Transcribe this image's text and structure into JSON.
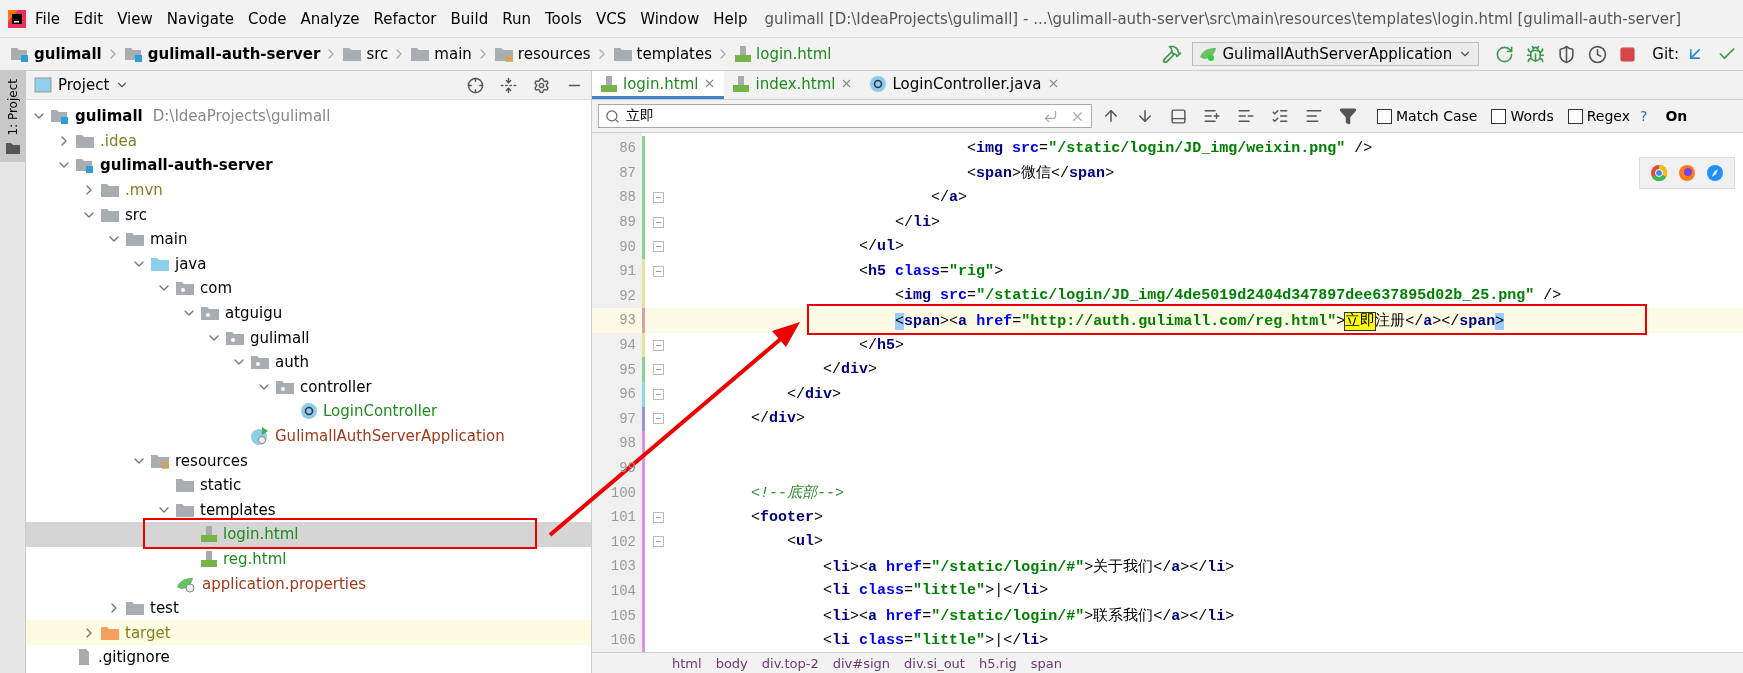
{
  "menu_bar": {
    "items": [
      "File",
      "Edit",
      "View",
      "Navigate",
      "Code",
      "Analyze",
      "Refactor",
      "Build",
      "Run",
      "Tools",
      "VCS",
      "Window",
      "Help"
    ],
    "title": "gulimall [D:\\IdeaProjects\\gulimall] - ...\\gulimall-auth-server\\src\\main\\resources\\templates\\login.html [gulimall-auth-server]"
  },
  "nav_bar": {
    "crumbs": [
      {
        "label": "gulimall",
        "kind": "module"
      },
      {
        "label": "gulimall-auth-server",
        "kind": "module"
      },
      {
        "label": "src",
        "kind": "folder"
      },
      {
        "label": "main",
        "kind": "folder"
      },
      {
        "label": "resources",
        "kind": "resource-folder"
      },
      {
        "label": "templates",
        "kind": "folder"
      },
      {
        "label": "login.html",
        "kind": "html"
      }
    ],
    "run_config": "GulimallAuthServerApplication",
    "git_label": "Git:"
  },
  "tool_stripe": {
    "label": "1: Project"
  },
  "project_panel": {
    "title": "Project",
    "tree": [
      {
        "label": "gulimall",
        "path": "D:\\IdeaProjects\\gulimall",
        "kind": "module",
        "color": "#000000",
        "expanded": true,
        "selected": false,
        "children": [
          {
            "label": ".idea",
            "kind": "folder",
            "color": "#7f7f20",
            "expanded": false,
            "selected": false
          },
          {
            "label": "gulimall-auth-server",
            "kind": "module",
            "color": "#000000",
            "expanded": true,
            "selected": false,
            "children": [
              {
                "label": ".mvn",
                "kind": "folder",
                "color": "#7f7f20",
                "expanded": false,
                "selected": false
              },
              {
                "label": "src",
                "kind": "folder",
                "color": "#000000",
                "expanded": true,
                "selected": false,
                "children": [
                  {
                    "label": "main",
                    "kind": "folder",
                    "color": "#000000",
                    "expanded": true,
                    "selected": false,
                    "children": [
                      {
                        "label": "java",
                        "kind": "source-folder",
                        "color": "#000000",
                        "expanded": true,
                        "selected": false,
                        "children": [
                          {
                            "label": "com",
                            "kind": "package",
                            "color": "#000000",
                            "expanded": true,
                            "selected": false,
                            "children": [
                              {
                                "label": "atguigu",
                                "kind": "package",
                                "color": "#000000",
                                "expanded": true,
                                "selected": false,
                                "children": [
                                  {
                                    "label": "gulimall",
                                    "kind": "package",
                                    "color": "#000000",
                                    "expanded": true,
                                    "selected": false,
                                    "children": [
                                      {
                                        "label": "auth",
                                        "kind": "package",
                                        "color": "#000000",
                                        "expanded": true,
                                        "selected": false,
                                        "children": [
                                          {
                                            "label": "controller",
                                            "kind": "package",
                                            "color": "#000000",
                                            "expanded": true,
                                            "selected": false,
                                            "children": [
                                              {
                                                "label": "LoginController",
                                                "kind": "class",
                                                "color": "#1e8a1e",
                                                "selected": false
                                              }
                                            ]
                                          }
                                        ]
                                      },
                                      {
                                        "label": "GulimallAuthServerApplication",
                                        "kind": "app-class",
                                        "color": "#a33a1a",
                                        "selected": false
                                      }
                                    ]
                                  }
                                ]
                              }
                            ]
                          }
                        ]
                      },
                      {
                        "label": "resources",
                        "kind": "resource-folder",
                        "color": "#000000",
                        "expanded": true,
                        "selected": false,
                        "children": [
                          {
                            "label": "static",
                            "kind": "folder",
                            "color": "#000000",
                            "selected": false
                          },
                          {
                            "label": "templates",
                            "kind": "folder",
                            "color": "#000000",
                            "expanded": true,
                            "selected": false,
                            "children": [
                              {
                                "label": "login.html",
                                "kind": "html",
                                "color": "#1e8a1e",
                                "selected": true
                              },
                              {
                                "label": "reg.html",
                                "kind": "html",
                                "color": "#1e8a1e",
                                "selected": false
                              }
                            ]
                          },
                          {
                            "label": "application.properties",
                            "kind": "properties",
                            "color": "#a33a1a",
                            "selected": false
                          }
                        ]
                      }
                    ]
                  },
                  {
                    "label": "test",
                    "kind": "folder",
                    "color": "#000000",
                    "expanded": false,
                    "selected": false
                  }
                ]
              },
              {
                "label": "target",
                "kind": "excluded-folder",
                "color": "#7f7f20",
                "expanded": false,
                "selected": false
              }
            ]
          },
          {
            "label": ".gitignore",
            "kind": "file",
            "color": "#000000",
            "selected": false
          }
        ]
      }
    ]
  },
  "editor": {
    "tabs": [
      {
        "label": "login.html",
        "kind": "html",
        "selected": true
      },
      {
        "label": "index.html",
        "kind": "html",
        "selected": false
      },
      {
        "label": "LoginController.java",
        "kind": "class",
        "selected": false
      }
    ],
    "search": {
      "value": "立即",
      "options": [
        {
          "label": "Match Case",
          "checked": false
        },
        {
          "label": "Words",
          "checked": false
        },
        {
          "label": "Regex",
          "checked": false
        }
      ],
      "help": "?",
      "cut_label": "On"
    },
    "lines": [
      {
        "number": "86",
        "color": "#8fd18f",
        "fold": false,
        "current": false,
        "tokens": [
          {
            "kind": "punct",
            "text": "                                <"
          },
          {
            "kind": "tag",
            "text": "img"
          },
          {
            "kind": "attr",
            "text": " src"
          },
          {
            "kind": "punct",
            "text": "="
          },
          {
            "kind": "value",
            "text": "\"/static/login/JD_img/weixin.png\""
          },
          {
            "kind": "punct",
            "text": " />"
          }
        ]
      },
      {
        "number": "87",
        "color": "#8fd18f",
        "fold": false,
        "current": false,
        "tokens": [
          {
            "kind": "punct",
            "text": "                                <"
          },
          {
            "kind": "tag",
            "text": "span"
          },
          {
            "kind": "punct",
            "text": ">"
          },
          {
            "kind": "text",
            "text": "微信"
          },
          {
            "kind": "punct",
            "text": "</"
          },
          {
            "kind": "tag",
            "text": "span"
          },
          {
            "kind": "punct",
            "text": ">"
          }
        ]
      },
      {
        "number": "88",
        "color": "#8fd18f",
        "fold": true,
        "current": false,
        "tokens": [
          {
            "kind": "punct",
            "text": "                            </"
          },
          {
            "kind": "tag",
            "text": "a"
          },
          {
            "kind": "punct",
            "text": ">"
          }
        ]
      },
      {
        "number": "89",
        "color": "#8fd18f",
        "fold": true,
        "current": false,
        "tokens": [
          {
            "kind": "punct",
            "text": "                        </"
          },
          {
            "kind": "tag",
            "text": "li"
          },
          {
            "kind": "punct",
            "text": ">"
          }
        ]
      },
      {
        "number": "90",
        "color": "#8fd18f",
        "fold": true,
        "current": false,
        "tokens": [
          {
            "kind": "punct",
            "text": "                    </"
          },
          {
            "kind": "tag",
            "text": "ul"
          },
          {
            "kind": "punct",
            "text": ">"
          }
        ]
      },
      {
        "number": "91",
        "color": "#e8e0a0",
        "fold": true,
        "current": false,
        "tokens": [
          {
            "kind": "punct",
            "text": "                    <"
          },
          {
            "kind": "tag",
            "text": "h5"
          },
          {
            "kind": "attr",
            "text": " class"
          },
          {
            "kind": "punct",
            "text": "="
          },
          {
            "kind": "value",
            "text": "\"rig\""
          },
          {
            "kind": "punct",
            "text": ">"
          }
        ]
      },
      {
        "number": "92",
        "color": "#e8e0a0",
        "fold": false,
        "current": false,
        "tokens": [
          {
            "kind": "punct",
            "text": "                        <"
          },
          {
            "kind": "tag",
            "text": "img"
          },
          {
            "kind": "attr",
            "text": " src"
          },
          {
            "kind": "punct",
            "text": "="
          },
          {
            "kind": "value",
            "text": "\"/static/login/JD_img/4de5019d2404d347897dee637895d02b_25.png\""
          },
          {
            "kind": "punct",
            "text": " />"
          }
        ]
      },
      {
        "number": "93",
        "color": "#e0a0a0",
        "fold": false,
        "current": true,
        "tokens": [
          {
            "kind": "brace",
            "text": "                        <"
          },
          {
            "kind": "tag",
            "text": "span"
          },
          {
            "kind": "punct",
            "text": "><"
          },
          {
            "kind": "tag",
            "text": "a"
          },
          {
            "kind": "attr",
            "text": " href"
          },
          {
            "kind": "punct",
            "text": "="
          },
          {
            "kind": "value",
            "text": "\"http://auth.gulimall.com/reg.html\""
          },
          {
            "kind": "punct",
            "text": ">"
          },
          {
            "kind": "match",
            "text": "立即"
          },
          {
            "kind": "text",
            "text": "注册"
          },
          {
            "kind": "punct",
            "text": "</"
          },
          {
            "kind": "tag",
            "text": "a"
          },
          {
            "kind": "punct",
            "text": "></"
          },
          {
            "kind": "tag",
            "text": "span"
          },
          {
            "kind": "brace",
            "text": ">"
          }
        ]
      },
      {
        "number": "94",
        "color": "#e8e0a0",
        "fold": true,
        "current": false,
        "tokens": [
          {
            "kind": "punct",
            "text": "                    </"
          },
          {
            "kind": "tag",
            "text": "h5"
          },
          {
            "kind": "punct",
            "text": ">"
          }
        ]
      },
      {
        "number": "95",
        "color": "#8fd18f",
        "fold": true,
        "current": false,
        "tokens": [
          {
            "kind": "punct",
            "text": "                </"
          },
          {
            "kind": "tag",
            "text": "div"
          },
          {
            "kind": "punct",
            "text": ">"
          }
        ]
      },
      {
        "number": "96",
        "color": "#8fd8e8",
        "fold": true,
        "current": false,
        "tokens": [
          {
            "kind": "punct",
            "text": "            </"
          },
          {
            "kind": "tag",
            "text": "div"
          },
          {
            "kind": "punct",
            "text": ">"
          }
        ]
      },
      {
        "number": "97",
        "color": "#9a8fe0",
        "fold": true,
        "current": false,
        "tokens": [
          {
            "kind": "punct",
            "text": "        </"
          },
          {
            "kind": "tag",
            "text": "div"
          },
          {
            "kind": "punct",
            "text": ">"
          }
        ]
      },
      {
        "number": "98",
        "color": "#e090e0",
        "fold": false,
        "current": false
      },
      {
        "number": "99",
        "color": "#e090e0",
        "fold": false,
        "current": false
      },
      {
        "number": "100",
        "color": "#e090e0",
        "fold": false,
        "current": false,
        "tokens": [
          {
            "kind": "comment",
            "text": "        <!--底部-->"
          }
        ]
      },
      {
        "number": "101",
        "color": "#e090e0",
        "fold": true,
        "current": false,
        "tokens": [
          {
            "kind": "punct",
            "text": "        <"
          },
          {
            "kind": "tag",
            "text": "footer"
          },
          {
            "kind": "punct",
            "text": ">"
          }
        ]
      },
      {
        "number": "102",
        "color": "#e090e0",
        "fold": true,
        "current": false,
        "tokens": [
          {
            "kind": "punct",
            "text": "            <"
          },
          {
            "kind": "tag",
            "text": "ul"
          },
          {
            "kind": "punct",
            "text": ">"
          }
        ]
      },
      {
        "number": "103",
        "color": "#e090e0",
        "fold": false,
        "current": false,
        "tokens": [
          {
            "kind": "punct",
            "text": "                <"
          },
          {
            "kind": "tag",
            "text": "li"
          },
          {
            "kind": "punct",
            "text": "><"
          },
          {
            "kind": "tag",
            "text": "a"
          },
          {
            "kind": "attr",
            "text": " href"
          },
          {
            "kind": "punct",
            "text": "="
          },
          {
            "kind": "value",
            "text": "\"/static/login/#\""
          },
          {
            "kind": "punct",
            "text": ">"
          },
          {
            "kind": "text",
            "text": "关于我们"
          },
          {
            "kind": "punct",
            "text": "</"
          },
          {
            "kind": "tag",
            "text": "a"
          },
          {
            "kind": "punct",
            "text": "></"
          },
          {
            "kind": "tag",
            "text": "li"
          },
          {
            "kind": "punct",
            "text": ">"
          }
        ]
      },
      {
        "number": "104",
        "color": "#e090e0",
        "fold": false,
        "current": false,
        "tokens": [
          {
            "kind": "punct",
            "text": "                <"
          },
          {
            "kind": "tag",
            "text": "li"
          },
          {
            "kind": "attr",
            "text": " class"
          },
          {
            "kind": "punct",
            "text": "="
          },
          {
            "kind": "value",
            "text": "\"little\""
          },
          {
            "kind": "punct",
            "text": ">"
          },
          {
            "kind": "text",
            "text": "|"
          },
          {
            "kind": "punct",
            "text": "</"
          },
          {
            "kind": "tag",
            "text": "li"
          },
          {
            "kind": "punct",
            "text": ">"
          }
        ]
      },
      {
        "number": "105",
        "color": "#e090e0",
        "fold": false,
        "current": false,
        "tokens": [
          {
            "kind": "punct",
            "text": "                <"
          },
          {
            "kind": "tag",
            "text": "li"
          },
          {
            "kind": "punct",
            "text": "><"
          },
          {
            "kind": "tag",
            "text": "a"
          },
          {
            "kind": "attr",
            "text": " href"
          },
          {
            "kind": "punct",
            "text": "="
          },
          {
            "kind": "value",
            "text": "\"/static/login/#\""
          },
          {
            "kind": "punct",
            "text": ">"
          },
          {
            "kind": "text",
            "text": "联系我们"
          },
          {
            "kind": "punct",
            "text": "</"
          },
          {
            "kind": "tag",
            "text": "a"
          },
          {
            "kind": "punct",
            "text": "></"
          },
          {
            "kind": "tag",
            "text": "li"
          },
          {
            "kind": "punct",
            "text": ">"
          }
        ]
      },
      {
        "number": "106",
        "color": "#e090e0",
        "fold": false,
        "current": false,
        "tokens": [
          {
            "kind": "punct",
            "text": "                <"
          },
          {
            "kind": "tag",
            "text": "li"
          },
          {
            "kind": "attr",
            "text": " class"
          },
          {
            "kind": "punct",
            "text": "="
          },
          {
            "kind": "value",
            "text": "\"little\""
          },
          {
            "kind": "punct",
            "text": ">"
          },
          {
            "kind": "text",
            "text": "|"
          },
          {
            "kind": "punct",
            "text": "</"
          },
          {
            "kind": "tag",
            "text": "li"
          },
          {
            "kind": "punct",
            "text": ">"
          }
        ]
      }
    ],
    "breadcrumbs": [
      "html",
      "body",
      "div.top-2",
      "div#sign",
      "div.si_out",
      "h5.rig",
      "span"
    ]
  }
}
